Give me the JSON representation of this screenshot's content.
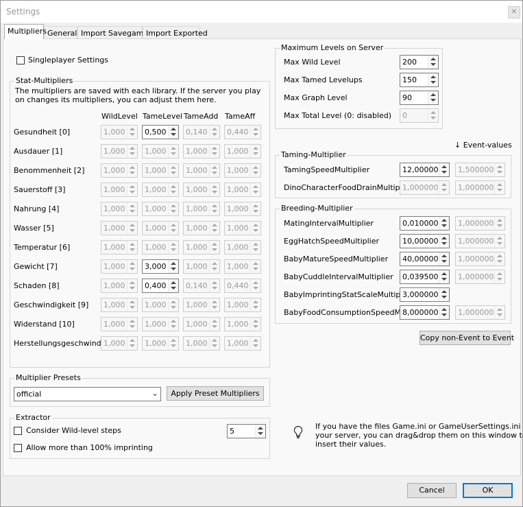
{
  "window": {
    "title": "Settings"
  },
  "tabs": [
    "Multipliers",
    "General",
    "Import Savegame",
    "Import Exported"
  ],
  "singleplayer": {
    "label": "Singleplayer Settings"
  },
  "stat_multipliers": {
    "title": "Stat-Multipliers",
    "note_line1": "The multipliers are saved with each library. If the server you play",
    "note_line2": "on changes its multipliers, you can adjust them here.",
    "columns": [
      "WildLevel",
      "TameLevel",
      "TameAdd",
      "TameAff"
    ],
    "rows": [
      {
        "name": "Gesundheit [0]",
        "values": [
          "1,000",
          "0,500",
          "0,140",
          "0,440"
        ],
        "enabled": [
          false,
          true,
          false,
          false
        ]
      },
      {
        "name": "Ausdauer [1]",
        "values": [
          "1,000",
          "1,000",
          "1,000",
          "1,000"
        ],
        "enabled": [
          false,
          false,
          false,
          false
        ]
      },
      {
        "name": "Benommenheit [2]",
        "values": [
          "1,000",
          "1,000",
          "1,000",
          "1,000"
        ],
        "enabled": [
          false,
          false,
          false,
          false
        ]
      },
      {
        "name": "Sauerstoff [3]",
        "values": [
          "1,000",
          "1,000",
          "1,000",
          "1,000"
        ],
        "enabled": [
          false,
          false,
          false,
          false
        ]
      },
      {
        "name": "Nahrung [4]",
        "values": [
          "1,000",
          "1,000",
          "1,000",
          "1,000"
        ],
        "enabled": [
          false,
          false,
          false,
          false
        ]
      },
      {
        "name": "Wasser [5]",
        "values": [
          "1,000",
          "1,000",
          "1,000",
          "1,000"
        ],
        "enabled": [
          false,
          false,
          false,
          false
        ]
      },
      {
        "name": "Temperatur [6]",
        "values": [
          "1,000",
          "1,000",
          "1,000",
          "1,000"
        ],
        "enabled": [
          false,
          false,
          false,
          false
        ]
      },
      {
        "name": "Gewicht [7]",
        "values": [
          "1,000",
          "3,000",
          "1,000",
          "1,000"
        ],
        "enabled": [
          false,
          true,
          false,
          false
        ]
      },
      {
        "name": "Schaden [8]",
        "values": [
          "1,000",
          "0,400",
          "0,140",
          "0,440"
        ],
        "enabled": [
          false,
          true,
          false,
          false
        ]
      },
      {
        "name": "Geschwindigkeit [9]",
        "values": [
          "1,000",
          "1,000",
          "1,000",
          "1,000"
        ],
        "enabled": [
          false,
          false,
          false,
          false
        ]
      },
      {
        "name": "Widerstand [10]",
        "values": [
          "1,000",
          "1,000",
          "1,000",
          "1,000"
        ],
        "enabled": [
          false,
          false,
          false,
          false
        ]
      },
      {
        "name": "Herstellungsgeschwindigke",
        "values": [
          "1,000",
          "1,000",
          "1,000",
          "1,000"
        ],
        "enabled": [
          false,
          false,
          false,
          false
        ]
      }
    ]
  },
  "presets": {
    "title": "Multiplier Presets",
    "selected": "official",
    "apply_label": "Apply Preset Multipliers"
  },
  "extractor": {
    "title": "Extractor",
    "wild_steps_label": "Consider Wild-level steps",
    "wild_steps_value": "5",
    "imprinting_label": "Allow more than 100% imprinting"
  },
  "max_levels": {
    "title": "Maximum Levels on Server",
    "rows": [
      {
        "label": "Max Wild Level",
        "value": "200",
        "enabled": true
      },
      {
        "label": "Max Tamed Levelups",
        "value": "150",
        "enabled": true
      },
      {
        "label": "Max Graph Level",
        "value": "90",
        "enabled": true
      },
      {
        "label": "Max Total Level (0: disabled)",
        "value": "0",
        "enabled": false
      }
    ]
  },
  "event_values_label": "↓ Event-values",
  "taming": {
    "title": "Taming-Multiplier",
    "rows": [
      {
        "label": "TamingSpeedMultiplier",
        "value": "12,000000",
        "event": "1,500000",
        "enabled": true
      },
      {
        "label": "DinoCharacterFoodDrainMultiplier",
        "value": "1,000000",
        "event": "1,000000",
        "enabled": false
      }
    ]
  },
  "breeding": {
    "title": "Breeding-Multiplier",
    "rows": [
      {
        "label": "MatingIntervalMultiplier",
        "value": "0,010000",
        "event": "1,000000",
        "enabled": true
      },
      {
        "label": "EggHatchSpeedMultiplier",
        "value": "10,000000",
        "event": "1,000000",
        "enabled": true
      },
      {
        "label": "BabyMatureSpeedMultiplier",
        "value": "40,000000",
        "event": "1,000000",
        "enabled": true
      },
      {
        "label": "BabyCuddleIntervalMultiplier",
        "value": "0,039500",
        "event": "1,000000",
        "enabled": true
      },
      {
        "label": "BabyImprintingStatScaleMultiplier",
        "value": "3,000000",
        "event": null,
        "enabled": true
      },
      {
        "label": "BabyFoodConsumptionSpeedMult",
        "value": "8,000000",
        "event": "1,000000",
        "enabled": true
      }
    ]
  },
  "copy_button": "Copy non-Event to Event",
  "hint": {
    "icon": "lightbulb-icon",
    "line1": "If you have the files Game.ini or GameUserSettings.ini from",
    "line2": "your server, you can drag&drop them on this window to",
    "line3": "insert their values."
  },
  "footer": {
    "cancel": "Cancel",
    "ok": "OK"
  },
  "colors": {
    "accent": "#0078d7",
    "panel": "#f9f9f9",
    "window": "#f0f0f0"
  }
}
